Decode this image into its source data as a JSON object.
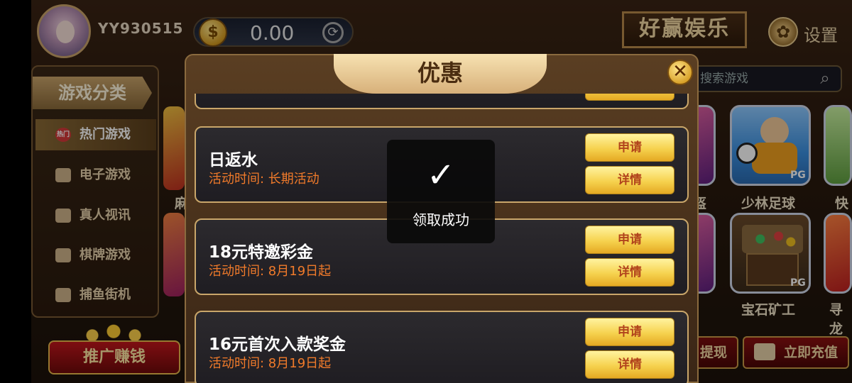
{
  "user": {
    "username": "YY930515",
    "balance": "0.00"
  },
  "brand": "好赢娱乐",
  "settings_label": "设置",
  "sidebar": {
    "title": "游戏分类",
    "items": [
      {
        "label": "热门游戏",
        "badge": "热门"
      },
      {
        "label": "电子游戏"
      },
      {
        "label": "真人视讯"
      },
      {
        "label": "棋牌游戏"
      },
      {
        "label": "捕鱼街机"
      }
    ]
  },
  "promote_label": "推广赚钱",
  "search_placeholder": "搜索游戏",
  "games": [
    {
      "name": "少林足球",
      "provider": "PG"
    },
    {
      "name": "宝石矿工",
      "provider": "PG"
    }
  ],
  "partial_labels": {
    "tile_a": "麻",
    "tile_b": "盔",
    "tile_c": "快",
    "tile_d": "寻龙"
  },
  "withdraw_label": "提现",
  "recharge_label": "立即充值",
  "modal": {
    "title": "优惠",
    "close_glyph": "✕",
    "items": [
      {
        "title": "日返水",
        "time": "活动时间: 长期活动",
        "apply": "申请",
        "detail": "详情"
      },
      {
        "title": "18元特邀彩金",
        "time": "活动时间: 8月19日起",
        "apply": "申请",
        "detail": "详情"
      },
      {
        "title": "16元首次入款奖金",
        "time": "活动时间: 8月19日起",
        "apply": "申请",
        "detail": "详情"
      }
    ]
  },
  "toast": {
    "message": "领取成功"
  },
  "icons": {
    "coin": "coin-icon",
    "refresh": "refresh-icon",
    "settings": "gear-icon",
    "search": "search-icon",
    "check": "check-icon",
    "wallet": "wallet-icon"
  }
}
